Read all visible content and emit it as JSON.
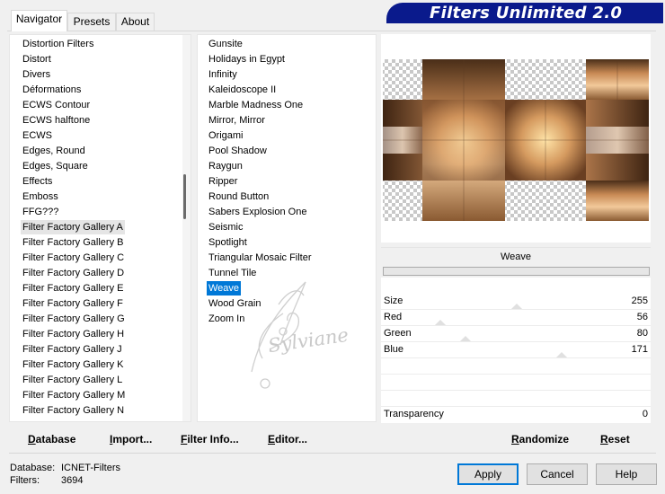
{
  "window": {
    "title": "Filters Unlimited 2.0"
  },
  "tabs": [
    {
      "label": "Navigator"
    },
    {
      "label": "Presets"
    },
    {
      "label": "About"
    }
  ],
  "categories": {
    "items": [
      "Distortion Filters",
      "Distort",
      "Divers",
      "Déformations",
      "ECWS Contour",
      "ECWS halftone",
      "ECWS",
      "Edges, Round",
      "Edges, Square",
      "Effects",
      "Emboss",
      "FFG???",
      "Filter Factory Gallery A",
      "Filter Factory Gallery B",
      "Filter Factory Gallery C",
      "Filter Factory Gallery D",
      "Filter Factory Gallery E",
      "Filter Factory Gallery F",
      "Filter Factory Gallery G",
      "Filter Factory Gallery H",
      "Filter Factory Gallery J",
      "Filter Factory Gallery K",
      "Filter Factory Gallery L",
      "Filter Factory Gallery M",
      "Filter Factory Gallery N"
    ],
    "selected": "Filter Factory Gallery A"
  },
  "filters": {
    "items": [
      "Gunsite",
      "Holidays in Egypt",
      "Infinity",
      "Kaleidoscope II",
      "Marble Madness One",
      "Mirror, Mirror",
      "Origami",
      "Pool Shadow",
      "Raygun",
      "Ripper",
      "Round Button",
      "Sabers Explosion One",
      "Seismic",
      "Spotlight",
      "Triangular Mosaic Filter",
      "Tunnel Tile",
      "Weave",
      "Wood Grain",
      "Zoom In"
    ],
    "selected": "Weave"
  },
  "watermark": {
    "text": "Sylviane"
  },
  "preview": {
    "effect_name": "Weave"
  },
  "params": [
    {
      "label": "Size",
      "value": "255"
    },
    {
      "label": "Red",
      "value": "56"
    },
    {
      "label": "Green",
      "value": "80"
    },
    {
      "label": "Blue",
      "value": "171"
    },
    {
      "label": "Transparency",
      "value": "0"
    }
  ],
  "bottom_left": {
    "database": "Database",
    "import": "Import...",
    "filter_info": "Filter Info...",
    "editor": "Editor..."
  },
  "bottom_right": {
    "randomize": "Randomize",
    "reset": "Reset"
  },
  "status": {
    "database_label": "Database:",
    "database_value": "ICNET-Filters",
    "filters_label": "Filters:",
    "filters_value": "3694"
  },
  "buttons": {
    "apply": "Apply",
    "cancel": "Cancel",
    "help": "Help"
  },
  "colors": {
    "banner": "#0a1a8c",
    "selection": "#0078d7"
  }
}
